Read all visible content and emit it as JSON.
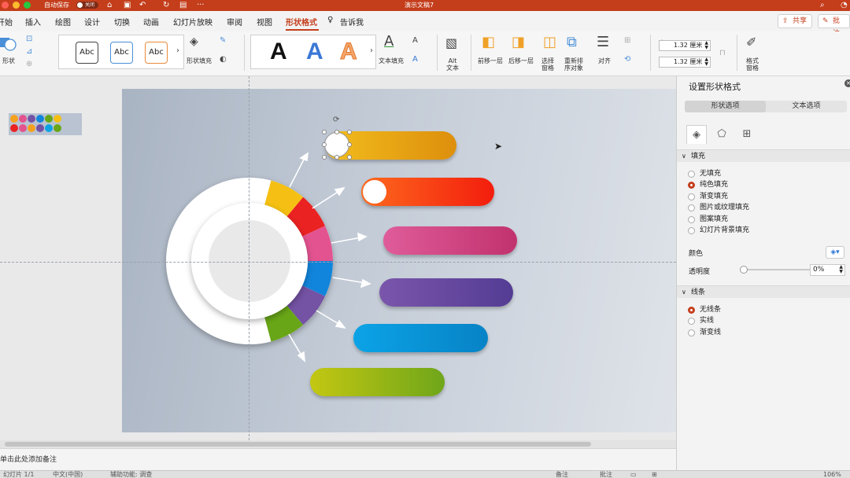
{
  "titlebar": {
    "autosave_label": "自动保存",
    "autosave_state": "关闭",
    "doc_title": "演示文稿7",
    "traffic_colors": [
      "#fe5f57",
      "#febc2e",
      "#28c840"
    ]
  },
  "tabs": {
    "items": [
      {
        "label": "开始"
      },
      {
        "label": "插入"
      },
      {
        "label": "绘图"
      },
      {
        "label": "设计"
      },
      {
        "label": "切换"
      },
      {
        "label": "动画"
      },
      {
        "label": "幻灯片放映"
      },
      {
        "label": "审阅"
      },
      {
        "label": "视图"
      },
      {
        "label": "形状格式"
      }
    ],
    "tell_me": "告诉我",
    "share": "共享",
    "comments": "批注"
  },
  "ribbon": {
    "shape_label": "形状",
    "style_abc": [
      "Abc",
      "Abc",
      "Abc"
    ],
    "shape_fill": "形状填充",
    "wordart_letter": "A",
    "text_fill": "文本填充",
    "alt_text": "Alt\n文本",
    "bring_forward": "前移一层",
    "send_backward": "后移一层",
    "selection_pane": "选择\n窗格",
    "reorder": "重新排\n序对象",
    "align": "对齐",
    "height": "1.32 厘米",
    "width": "1.32 厘米",
    "format_pane": "格式\n窗格"
  },
  "slide": {
    "bar_colors": [
      [
        "#f2bd1d",
        "#dd8f0c"
      ],
      [
        "#fd6a1e",
        "#f31d0d"
      ],
      [
        "#df5c9a",
        "#c1326d"
      ],
      [
        "#7a56ab",
        "#543c94"
      ],
      [
        "#0ba3e6",
        "#0783c6"
      ],
      [
        "#c3c712",
        "#6fa61a"
      ]
    ],
    "ring_colors": [
      "#f5c013",
      "#ea2222",
      "#e2538f",
      "#1185db",
      "#7452a4",
      "#68a617"
    ],
    "thumb_colors": [
      "#f5a11e",
      "#e2538f",
      "#7452a4",
      "#1185db",
      "#68a617",
      "#f5c013",
      "#ea2222",
      "#0ba3e6"
    ]
  },
  "notes": {
    "placeholder": "单击此处添加备注"
  },
  "status": {
    "slide_count": "幻灯片 1/1",
    "language": "中文(中国)",
    "accessibility": "辅助功能: 调查",
    "notes_btn": "备注",
    "comments_btn": "批注",
    "zoom": "106%"
  },
  "pane": {
    "title": "设置形状格式",
    "tab_shape": "形状选项",
    "tab_text": "文本选项",
    "fill_section": "填充",
    "fill_options": [
      {
        "label": "无填充",
        "selected": false
      },
      {
        "label": "纯色填充",
        "selected": true
      },
      {
        "label": "渐变填充",
        "selected": false
      },
      {
        "label": "图片或纹理填充",
        "selected": false
      },
      {
        "label": "图案填充",
        "selected": false
      },
      {
        "label": "幻灯片背景填充",
        "selected": false
      }
    ],
    "color_label": "颜色",
    "transparency_label": "透明度",
    "transparency_value": "0%",
    "line_section": "线条",
    "line_options": [
      {
        "label": "无线条",
        "selected": true
      },
      {
        "label": "实线",
        "selected": false
      },
      {
        "label": "渐变线",
        "selected": false
      }
    ]
  }
}
